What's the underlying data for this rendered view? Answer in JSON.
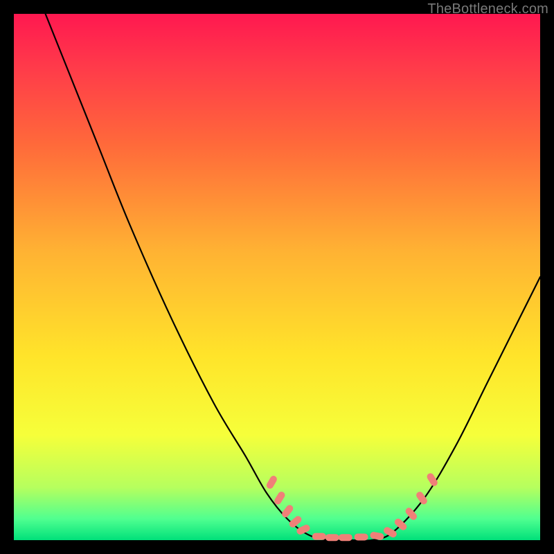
{
  "watermark": "TheBottleneck.com",
  "colors": {
    "curve_stroke": "#000000",
    "marker_fill": "#f08078",
    "marker_stroke": "#c85a52"
  },
  "chart_data": {
    "type": "line",
    "title": "",
    "xlabel": "",
    "ylabel": "",
    "xlim": [
      0,
      100
    ],
    "ylim": [
      0,
      100
    ],
    "grid": false,
    "legend": false,
    "curve": [
      {
        "x": 6,
        "y": 100
      },
      {
        "x": 10,
        "y": 90
      },
      {
        "x": 16,
        "y": 75
      },
      {
        "x": 22,
        "y": 60
      },
      {
        "x": 30,
        "y": 42
      },
      {
        "x": 38,
        "y": 26
      },
      {
        "x": 44,
        "y": 16
      },
      {
        "x": 48,
        "y": 9
      },
      {
        "x": 52,
        "y": 4
      },
      {
        "x": 56,
        "y": 1
      },
      {
        "x": 60,
        "y": 0
      },
      {
        "x": 64,
        "y": 0
      },
      {
        "x": 68,
        "y": 0
      },
      {
        "x": 72,
        "y": 1.5
      },
      {
        "x": 78,
        "y": 8
      },
      {
        "x": 84,
        "y": 18
      },
      {
        "x": 90,
        "y": 30
      },
      {
        "x": 96,
        "y": 42
      },
      {
        "x": 100,
        "y": 50
      }
    ],
    "markers": [
      {
        "x": 49,
        "y": 11,
        "angle": -60
      },
      {
        "x": 50.5,
        "y": 8,
        "angle": -58
      },
      {
        "x": 52,
        "y": 5.5,
        "angle": -52
      },
      {
        "x": 53.5,
        "y": 3.5,
        "angle": -40
      },
      {
        "x": 55,
        "y": 2,
        "angle": -25
      },
      {
        "x": 58,
        "y": 0.7,
        "angle": 0
      },
      {
        "x": 60.5,
        "y": 0.5,
        "angle": 0
      },
      {
        "x": 63,
        "y": 0.5,
        "angle": 0
      },
      {
        "x": 66,
        "y": 0.6,
        "angle": 0
      },
      {
        "x": 69,
        "y": 0.8,
        "angle": 10
      },
      {
        "x": 71.5,
        "y": 1.5,
        "angle": 30
      },
      {
        "x": 73.5,
        "y": 3,
        "angle": 42
      },
      {
        "x": 75.5,
        "y": 5,
        "angle": 50
      },
      {
        "x": 77.5,
        "y": 8,
        "angle": 55
      },
      {
        "x": 79.5,
        "y": 11.5,
        "angle": 58
      }
    ]
  }
}
